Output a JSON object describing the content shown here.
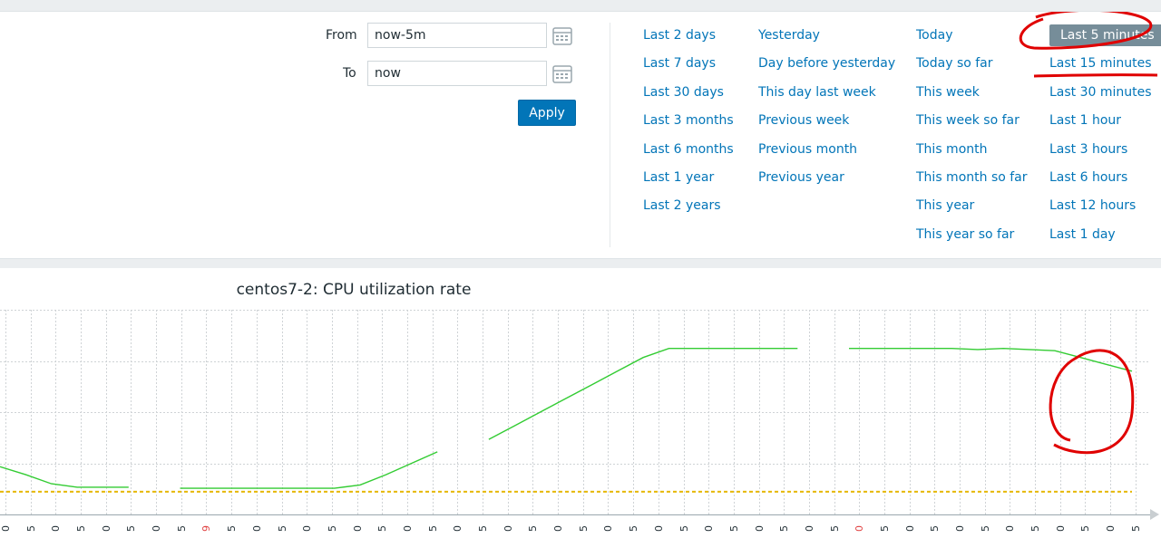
{
  "time_filter": {
    "from_label": "From",
    "from_value": "now-5m",
    "to_label": "To",
    "to_value": "now",
    "apply_label": "Apply"
  },
  "quick_ranges": {
    "col1": [
      "Last 2 days",
      "Last 7 days",
      "Last 30 days",
      "Last 3 months",
      "Last 6 months",
      "Last 1 year",
      "Last 2 years"
    ],
    "col2": [
      "Yesterday",
      "Day before yesterday",
      "This day last week",
      "Previous week",
      "Previous month",
      "Previous year"
    ],
    "col3": [
      "Today",
      "Today so far",
      "This week",
      "This week so far",
      "This month",
      "This month so far",
      "This year",
      "This year so far"
    ],
    "col4": [
      "Last 5 minutes",
      "Last 15 minutes",
      "Last 30 minutes",
      "Last 1 hour",
      "Last 3 hours",
      "Last 6 hours",
      "Last 12 hours",
      "Last 1 day"
    ],
    "selected": "Last 5 minutes"
  },
  "chart": {
    "title": "centos7-2: CPU utilization rate"
  },
  "chart_data": {
    "type": "line",
    "title": "centos7-2: CPU utilization rate",
    "xlabel": "",
    "ylabel": "",
    "x_tick_labels": [
      "0",
      "5",
      "0",
      "5",
      "0",
      "5",
      "0",
      "5",
      "9",
      "5",
      "0",
      "5",
      "0",
      "5",
      "0",
      "5",
      "0",
      "5",
      "0",
      "5",
      "0",
      "5",
      "0",
      "5",
      "0",
      "5",
      "0",
      "5",
      "0",
      "5",
      "0",
      "5",
      "0",
      "5",
      "0",
      "5",
      "0",
      "5",
      "0",
      "5",
      "0",
      "5",
      "0",
      "5",
      "0",
      "5"
    ],
    "red_tick_indices": [
      8,
      34,
      58
    ],
    "series": [
      {
        "color": "#33cc33",
        "values": [
          0.42,
          0.35,
          0.27,
          0.24,
          0.24,
          0.24,
          null,
          0.23,
          0.23,
          0.23,
          0.23,
          0.23,
          0.23,
          0.23,
          0.26,
          0.35,
          0.45,
          0.55,
          null,
          0.66,
          0.78,
          0.9,
          1.02,
          1.14,
          1.26,
          1.38,
          1.46,
          1.46,
          1.46,
          1.46,
          1.46,
          1.46,
          null,
          1.46,
          1.46,
          1.46,
          1.46,
          1.46,
          1.45,
          1.46,
          1.45,
          1.44,
          1.38,
          1.32,
          1.26
        ]
      },
      {
        "color": "#e6b800",
        "style": "dashed",
        "values": [
          0.2,
          0.2,
          0.2,
          0.2,
          0.2,
          0.2,
          0.2,
          0.2,
          0.2,
          0.2,
          0.2,
          0.2,
          0.2,
          0.2,
          0.2,
          0.2,
          0.2,
          0.2,
          0.2,
          0.2,
          0.2,
          0.2,
          0.2,
          0.2,
          0.2,
          0.2,
          0.2,
          0.2,
          0.2,
          0.2,
          0.2,
          0.2,
          0.2,
          0.2,
          0.2,
          0.2,
          0.2,
          0.2,
          0.2,
          0.2,
          0.2,
          0.2,
          0.2,
          0.2,
          0.2
        ]
      }
    ],
    "grid": true
  },
  "colors": {
    "link": "#0275b8",
    "button": "#0275b8",
    "selected_bg": "#768d99",
    "annotation": "#e00000"
  }
}
